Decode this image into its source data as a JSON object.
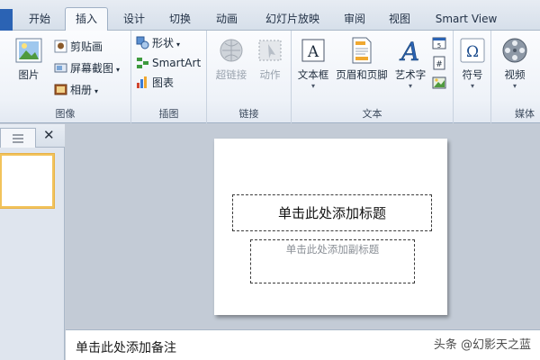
{
  "tabs": [
    {
      "label": "开始"
    },
    {
      "label": "插入",
      "active": true
    },
    {
      "label": "设计"
    },
    {
      "label": "切换"
    },
    {
      "label": "动画"
    },
    {
      "label": "幻灯片放映"
    },
    {
      "label": "审阅"
    },
    {
      "label": "视图"
    },
    {
      "label": "Smart View"
    }
  ],
  "ribbon": {
    "images": {
      "picture": "图片",
      "clipart": "剪贴画",
      "screenshot": "屏幕截图",
      "album": "相册",
      "label": "图像"
    },
    "illustrations": {
      "shapes": "形状",
      "smartart": "SmartArt",
      "chart": "图表",
      "label": "插图"
    },
    "links": {
      "hyperlink": "超链接",
      "action": "动作",
      "label": "链接"
    },
    "text": {
      "textbox": "文本框",
      "header_footer": "页眉和页脚",
      "wordart": "艺术字",
      "label": "文本"
    },
    "symbols": {
      "symbol": "符号"
    },
    "media": {
      "video": "视频",
      "label": "媒体"
    }
  },
  "slide": {
    "title_placeholder": "单击此处添加标题",
    "subtitle_placeholder": "单击此处添加副标题"
  },
  "notes": {
    "placeholder": "单击此处添加备注"
  },
  "watermark": "头条 @幻影天之蓝",
  "colors": {
    "accent": "#2b63b4",
    "selection": "#f2c35b"
  }
}
